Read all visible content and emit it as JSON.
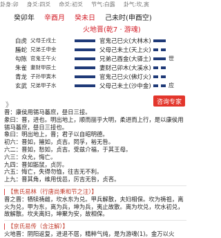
{
  "topbar": [
    "卦身:卯",
    "身爻:四爻",
    "命爻:初爻",
    "节气:白露",
    "卦气:坎,寅"
  ],
  "ganzhi": [
    {
      "text": "癸卯年",
      "red": false
    },
    {
      "text": "辛酉月",
      "red": true
    },
    {
      "text": "癸未日",
      "red": true
    },
    {
      "text": "己未时(申酉空)",
      "red": false
    }
  ],
  "gua_title": "火地晋(乾7 · 游魂)",
  "yao": [
    {
      "god": "白虎",
      "fu": "父母壬戌土",
      "yang": true,
      "main": "官鬼己巳火(大林木)",
      "main_yang": true,
      "mark": ""
    },
    {
      "god": "螣蛇",
      "fu": "兄弟壬申金",
      "yang": true,
      "main": "父母己未土(天上火)",
      "main_yang": false,
      "mark": ""
    },
    {
      "god": "勾陈",
      "fu": "官鬼壬午火",
      "yang": true,
      "main": "兄弟己酉金(大驿土)",
      "main_yang": true,
      "mark": "世"
    },
    {
      "god": "朱雀",
      "fu": "妻财甲辰土",
      "yang": true,
      "main": "妻财己卯木(大溪水)",
      "main_yang": false,
      "mark": ""
    },
    {
      "god": "青龙",
      "fu": "子孙甲寅木",
      "yang": true,
      "main": "官鬼己巳火(佛灯火)",
      "main_yang": false,
      "mark": ""
    },
    {
      "god": "玄武",
      "fu": "兄弟甲子水",
      "yang": true,
      "main": "父母己未土(沙中金)",
      "main_yang": false,
      "mark": "应"
    }
  ],
  "chevron": "》",
  "consult_button": "咨询专家",
  "text_lines": [
    "晋：康侯用锡马蕃庶，昼日三接。",
    "彖曰：晋，进也。明出地上，顺而丽乎大明，柔进而上行，是以康侯用锡马蕃庶，昼日三接也。",
    "象曰：明出地上，晋；君子以自昭明德。",
    "初六：晋如，摧如，贞吉。罔孚，裕无咎。",
    "六二：晋如，愁如，贞吉。受兹介福，于其王母。",
    "六三：众允，悔亡。",
    "九四：晋如鼫鼠，贞厉。",
    "六五：悔亡，失得勿恤，往吉无不利。",
    "上九：晋其角，维用伐邑，厉吉无咎，贞吝。"
  ],
  "section1": {
    "title": "【焦氏易林（行唐尚秉和节之注）】",
    "lines": [
      "晋之晋：牺犊祷雌，坎水东为兑。甲兵解散，夫妇相保。坎为祷祖，离火为兑，甲为东，离为兵，坤为兵，夷止故散。离为坎兑，坎水初兑，故解散。坎夫离妇，坤聚为安，故相保。"
    ]
  },
  "section2": {
    "title": "【京氏易传（含注解）】",
    "lines": [
      "火地晋：阴阳返复，进退不居，精粹气纯，是为游魂(1)。金万以火"
    ]
  }
}
